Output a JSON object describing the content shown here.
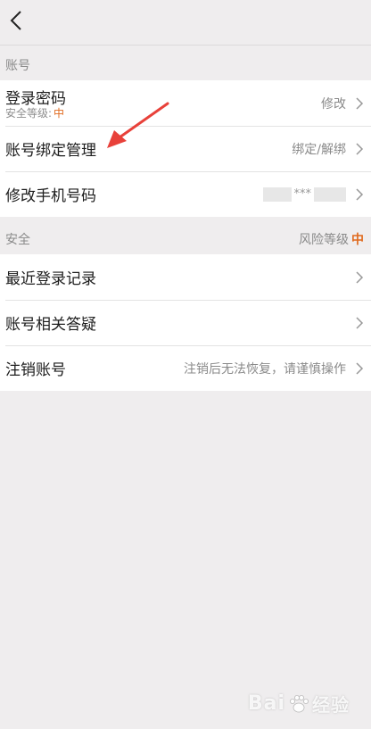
{
  "nav": {
    "back_icon": "chevron-left-icon"
  },
  "account_section": {
    "title": "账号",
    "rows": [
      {
        "label": "登录密码",
        "sub_prefix": "安全等级:",
        "sub_level": "中",
        "value": "修改"
      },
      {
        "label": "账号绑定管理",
        "value": "绑定/解绑"
      },
      {
        "label": "修改手机号码",
        "value_masked": "***"
      }
    ]
  },
  "security_section": {
    "title": "安全",
    "risk_label": "风险等级",
    "risk_value": "中",
    "rows": [
      {
        "label": "最近登录记录",
        "value": ""
      },
      {
        "label": "账号相关答疑",
        "value": ""
      },
      {
        "label": "注销账号",
        "value": "注销后无法恢复，请谨慎操作"
      }
    ]
  },
  "watermark": {
    "text_left": "Bai",
    "text_right": "经验"
  },
  "colors": {
    "background": "#efedee",
    "accent_orange": "#e06a1e",
    "annotation_red": "#e8413a"
  }
}
